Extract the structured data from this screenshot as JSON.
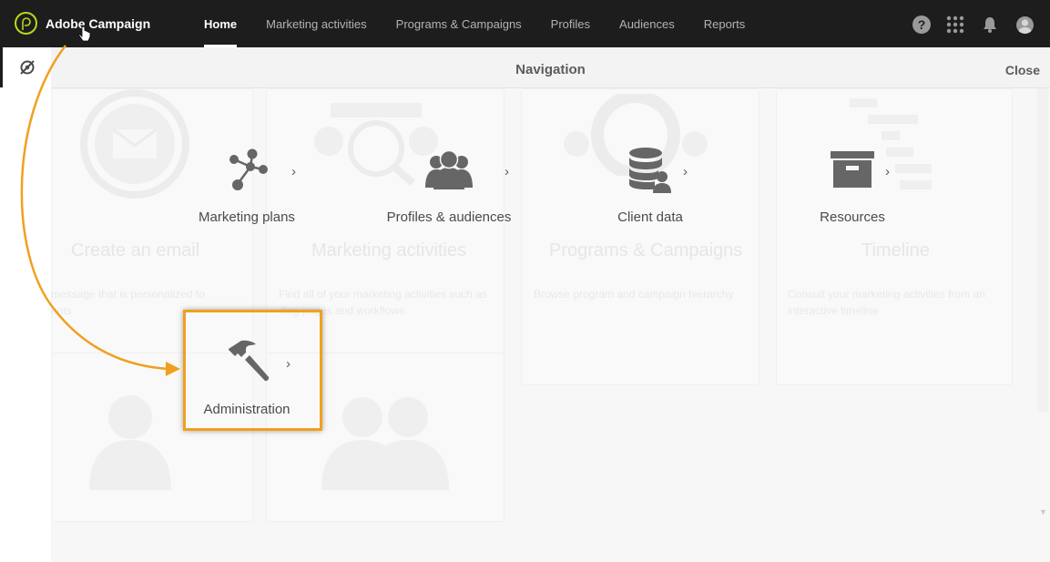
{
  "app": {
    "title": "Adobe Campaign"
  },
  "topnav": {
    "items": [
      {
        "label": "Home",
        "active": true
      },
      {
        "label": "Marketing activities"
      },
      {
        "label": "Programs & Campaigns"
      },
      {
        "label": "Profiles"
      },
      {
        "label": "Audiences"
      },
      {
        "label": "Reports"
      }
    ],
    "icons": [
      "help-icon",
      "app-grid-icon",
      "bell-icon",
      "user-avatar-icon"
    ],
    "help_glyph": "?"
  },
  "panel": {
    "title": "Navigation",
    "close_label": "Close"
  },
  "tiles": [
    {
      "label": "Marketing plans",
      "icon": "network-icon"
    },
    {
      "label": "Profiles & audiences",
      "icon": "users-group-icon"
    },
    {
      "label": "Client data",
      "icon": "database-user-icon"
    },
    {
      "label": "Resources",
      "icon": "archive-box-icon"
    },
    {
      "label": "Administration",
      "icon": "hammer-icon"
    }
  ],
  "chevron": "›",
  "background_cards": [
    {
      "title": "Create an email",
      "desc": "message that is personalized to\nents"
    },
    {
      "title": "Marketing activities",
      "desc": "Find all of your marketing activities such as\nding pages and workflows"
    },
    {
      "title": "Programs & Campaigns",
      "desc": "Browse program and campaign hierarchy"
    },
    {
      "title": "Timeline",
      "desc": "Consult your marketing activities from an\ninteractive timeline"
    }
  ],
  "colors": {
    "topbar": "#1d1d1d",
    "highlight": "#f0a01e",
    "logo_accent": "#b7d91d"
  }
}
